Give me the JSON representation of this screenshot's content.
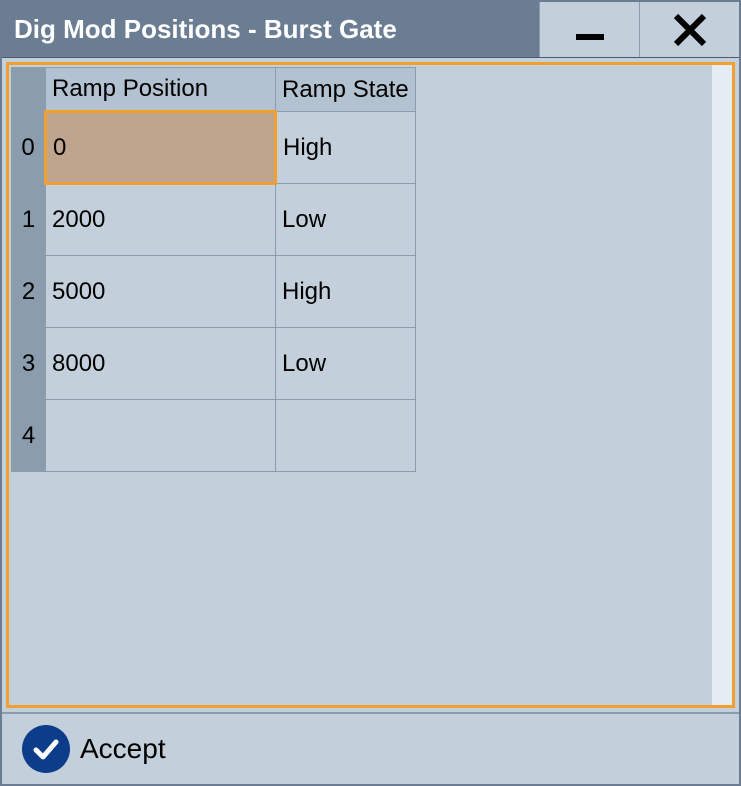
{
  "window": {
    "title": "Dig Mod Positions  - Burst Gate"
  },
  "table": {
    "headers": {
      "position": "Ramp Position",
      "state": "Ramp State"
    },
    "rows": [
      {
        "index": "0",
        "position": "0",
        "state": "High",
        "selected": true
      },
      {
        "index": "1",
        "position": "2000",
        "state": "Low",
        "selected": false
      },
      {
        "index": "2",
        "position": "5000",
        "state": "High",
        "selected": false
      },
      {
        "index": "3",
        "position": "8000",
        "state": "Low",
        "selected": false
      },
      {
        "index": "4",
        "position": "",
        "state": "",
        "selected": false
      }
    ]
  },
  "footer": {
    "accept_label": "Accept"
  },
  "icons": {
    "minimize": "minimize-icon",
    "close": "close-icon",
    "check": "check-icon"
  },
  "colors": {
    "titlebar": "#6a7d92",
    "accent": "#f0a030",
    "accept_circle": "#0d3d8a",
    "panel": "#c3d0db"
  }
}
